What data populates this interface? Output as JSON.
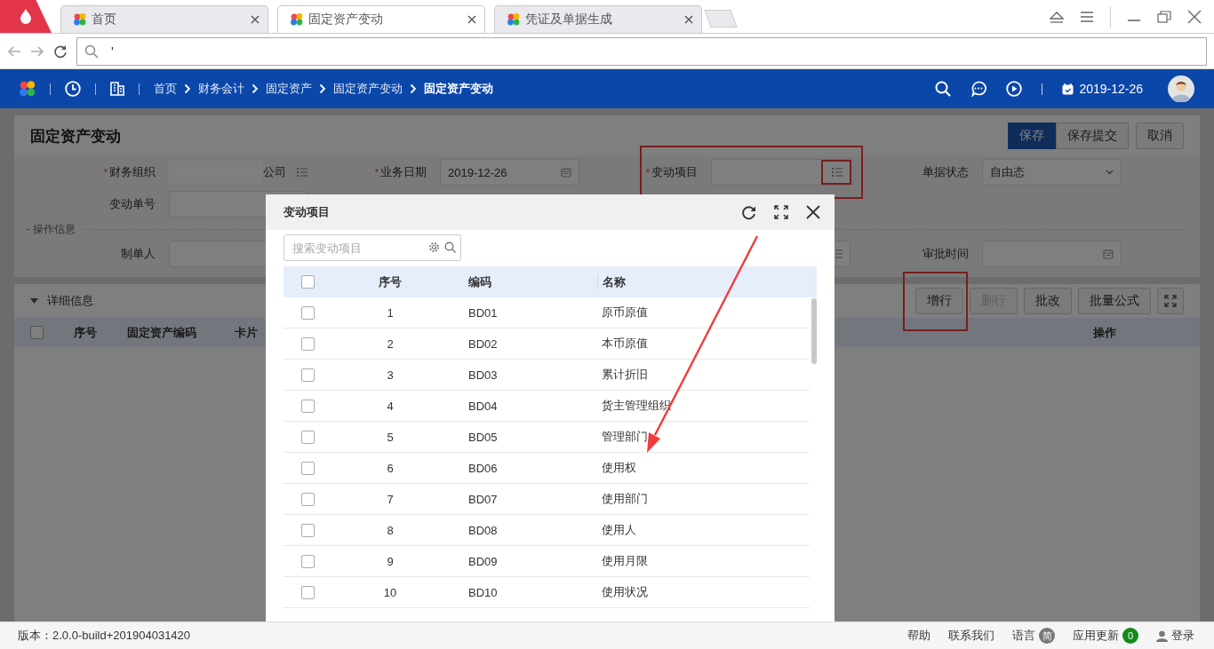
{
  "browser": {
    "tabs": [
      {
        "label": "首页",
        "selected": false
      },
      {
        "label": "固定资产变动",
        "selected": true
      },
      {
        "label": "凭证及单据生成",
        "selected": false
      }
    ],
    "address": "'"
  },
  "app_header": {
    "breadcrumb": [
      {
        "label": "首页",
        "current": false
      },
      {
        "label": "财务会计",
        "current": false
      },
      {
        "label": "固定资产",
        "current": false
      },
      {
        "label": "固定资产变动",
        "current": false
      },
      {
        "label": "固定资产变动",
        "current": true
      }
    ],
    "date": "2019-12-26"
  },
  "form": {
    "title": "固定资产变动",
    "actions": [
      {
        "label": "保存",
        "primary": true
      },
      {
        "label": "保存提交",
        "primary": false
      },
      {
        "label": "取消",
        "primary": false
      }
    ],
    "rows": [
      {
        "kind": "fields",
        "fields": [
          {
            "mark": "*",
            "label": "财务组织",
            "kind": "display",
            "value": "公司",
            "redacted": true
          },
          {
            "mark": "*",
            "label": "业务日期",
            "kind": "date",
            "value": "2019-12-26"
          },
          {
            "mark": "*",
            "label": "变动项目",
            "kind": "ref",
            "highlighted": true
          },
          {
            "label": "单据状态",
            "kind": "select",
            "value": "自由态"
          }
        ]
      },
      {
        "kind": "fields",
        "fields": [
          {
            "label": "变动单号",
            "kind": "text"
          }
        ]
      },
      {
        "kind": "section",
        "label": "- 操作信息"
      },
      {
        "kind": "fields",
        "fields": [
          {
            "label": "制单人",
            "kind": "text"
          },
          {
            "kind": "covered"
          },
          {
            "kind": "ref"
          },
          {
            "label": "审批时间",
            "kind": "date"
          }
        ]
      }
    ]
  },
  "detail": {
    "title": "详细信息",
    "expanded": true,
    "actions": [
      {
        "label": "增行",
        "disabled": false,
        "highlighted": true
      },
      {
        "label": "删行",
        "disabled": true
      },
      {
        "label": "批改",
        "disabled": false
      },
      {
        "label": "批量公式",
        "disabled": false
      }
    ],
    "all_checked": false,
    "columns": [
      "序号",
      "固定资产编码",
      "卡片"
    ],
    "action_column": "操作"
  },
  "modal": {
    "title": "变动项目",
    "search_placeholder": "搜索变动项目",
    "all_checked": false,
    "columns": [
      "序号",
      "编码",
      "名称"
    ],
    "rows": [
      {
        "no": "1",
        "code": "BD01",
        "name": "原币原值",
        "checked": false
      },
      {
        "no": "2",
        "code": "BD02",
        "name": "本币原值",
        "checked": false
      },
      {
        "no": "3",
        "code": "BD03",
        "name": "累计折旧",
        "checked": false
      },
      {
        "no": "4",
        "code": "BD04",
        "name": "货主管理组织",
        "checked": false
      },
      {
        "no": "5",
        "code": "BD05",
        "name": "管理部门",
        "checked": false
      },
      {
        "no": "6",
        "code": "BD06",
        "name": "使用权",
        "checked": false
      },
      {
        "no": "7",
        "code": "BD07",
        "name": "使用部门",
        "checked": false
      },
      {
        "no": "8",
        "code": "BD08",
        "name": "使用人",
        "checked": false
      },
      {
        "no": "9",
        "code": "BD09",
        "name": "使用月限",
        "checked": false
      },
      {
        "no": "10",
        "code": "BD10",
        "name": "使用状况",
        "checked": false
      }
    ]
  },
  "footer": {
    "version": "版本：2.0.0-build+201904031420",
    "links": [
      {
        "kind": "plain",
        "label": "帮助"
      },
      {
        "kind": "plain",
        "label": "联系我们"
      },
      {
        "kind": "lang",
        "label": "语言",
        "badge": "简"
      },
      {
        "kind": "count",
        "label": "应用更新",
        "badge": "0"
      },
      {
        "kind": "user",
        "label": "登录"
      }
    ]
  }
}
